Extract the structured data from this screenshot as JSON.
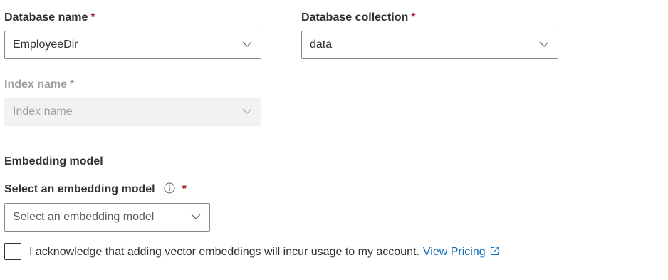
{
  "database_name": {
    "label": "Database name",
    "required_mark": "*",
    "value": "EmployeeDir"
  },
  "database_collection": {
    "label": "Database collection",
    "required_mark": "*",
    "value": "data"
  },
  "index_name": {
    "label": "Index name",
    "required_mark": "*",
    "placeholder": "Index name",
    "disabled": true
  },
  "embedding": {
    "section_title": "Embedding model",
    "select_label": "Select an embedding model",
    "required_mark": "*",
    "placeholder": "Select an embedding model"
  },
  "acknowledge": {
    "checked": false,
    "text": "I acknowledge that adding vector embeddings will incur usage to my account.",
    "link_text": "View Pricing"
  },
  "icons": {
    "chevron": "chevron-down-icon",
    "info": "info-icon",
    "external": "external-link-icon"
  },
  "colors": {
    "required": "#a4262c",
    "link": "#0f6cbd",
    "disabled_bg": "#f3f2f1",
    "disabled_text": "#a19f9d"
  }
}
